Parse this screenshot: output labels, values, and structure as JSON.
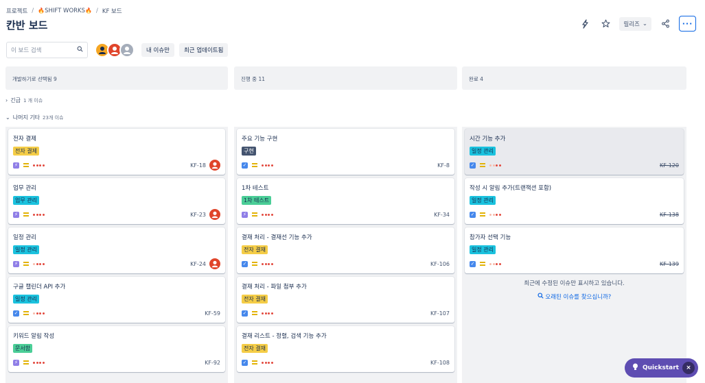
{
  "breadcrumb": {
    "items": [
      "프로젝트",
      "SHIFT WORKS",
      "KF 보드"
    ],
    "separator": "/"
  },
  "page_title": "칸반 보드",
  "top_actions": {
    "release_label": "릴리즈",
    "more_label": "···"
  },
  "toolbar": {
    "search_placeholder": "이 보드 검색",
    "filters": [
      "내 이슈만",
      "최근 업데이트됨"
    ]
  },
  "columns": [
    {
      "header": "개발하기로 선택됨 9"
    },
    {
      "header": "진행 중 11"
    },
    {
      "header": "완료 4"
    }
  ],
  "groups": [
    {
      "toggle": "›",
      "name": "긴급",
      "count": "1 개 이슈"
    },
    {
      "toggle": "⌄",
      "name": "나머지 기타",
      "count": "23개 이슈"
    }
  ],
  "cards": [
    [
      {
        "title": "전자 결제",
        "tag": "전자 결제",
        "tag_color": "yellow",
        "type": "epic",
        "priority_dots": "4",
        "key": "KF-18",
        "assignee": true
      },
      {
        "title": "업무 관리",
        "tag": "업무 관리",
        "tag_color": "cyan",
        "type": "epic",
        "priority_dots": "4",
        "key": "KF-23",
        "assignee": true
      },
      {
        "title": "일정 관리",
        "tag": "일정 관리",
        "tag_color": "cyan",
        "type": "epic",
        "priority_dots": "3",
        "key": "KF-24",
        "assignee": true
      },
      {
        "title": "구글 캘린더 API 추가",
        "tag": "일정 관리",
        "tag_color": "cyan",
        "type": "task",
        "priority_dots": "3",
        "key": "KF-59",
        "assignee": false
      },
      {
        "title": "키워드 알림 작성",
        "tag": "문서함",
        "tag_color": "green",
        "type": "epic",
        "priority_dots": "4",
        "key": "KF-92",
        "assignee": false
      }
    ],
    [
      {
        "title": "주요 기능 구현",
        "tag": "구현",
        "tag_color": "dark",
        "type": "task",
        "priority_dots": "4",
        "key": "KF-8",
        "assignee": false
      },
      {
        "title": "1차 테스트",
        "tag": "1차 테스트",
        "tag_color": "green",
        "type": "epic",
        "priority_dots": "4",
        "key": "KF-34",
        "assignee": false
      },
      {
        "title": "결재 처리 - 결재선 기능 추가",
        "tag": "전자 결재",
        "tag_color": "yellow",
        "type": "task",
        "priority_dots": "4",
        "key": "KF-106",
        "assignee": false
      },
      {
        "title": "결재 처리 - 파일 첨부 추가",
        "tag": "전자 결재",
        "tag_color": "yellow",
        "type": "task",
        "priority_dots": "4",
        "key": "KF-107",
        "assignee": false
      },
      {
        "title": "결재 리스트 - 정렬, 검색 기능 추가",
        "tag": "전자 결재",
        "tag_color": "yellow",
        "type": "task",
        "priority_dots": "4",
        "key": "KF-108",
        "assignee": false
      }
    ],
    [
      {
        "title": "시간 기능 추가",
        "tag": "일정 관리",
        "tag_color": "cyan",
        "type": "task",
        "priority_dots": "2",
        "key": "KF-120",
        "assignee": false,
        "highlighted": true
      },
      {
        "title": "작성 시 알림 추가(트랜잭션 포함)",
        "tag": "일정 관리",
        "tag_color": "cyan",
        "type": "task",
        "priority_dots": "2",
        "key": "KF-138",
        "assignee": false
      },
      {
        "title": "참가자 선택 기능",
        "tag": "일정 관리",
        "tag_color": "cyan",
        "type": "task",
        "priority_dots": "2",
        "key": "KF-139",
        "assignee": false
      }
    ]
  ],
  "done_note": "최근에 수정된 이슈만 표시하고 있습니다.",
  "done_link": "오래된 이슈를 찾으십니까?",
  "quickstart": {
    "label": "Quickstart",
    "close": "×"
  }
}
